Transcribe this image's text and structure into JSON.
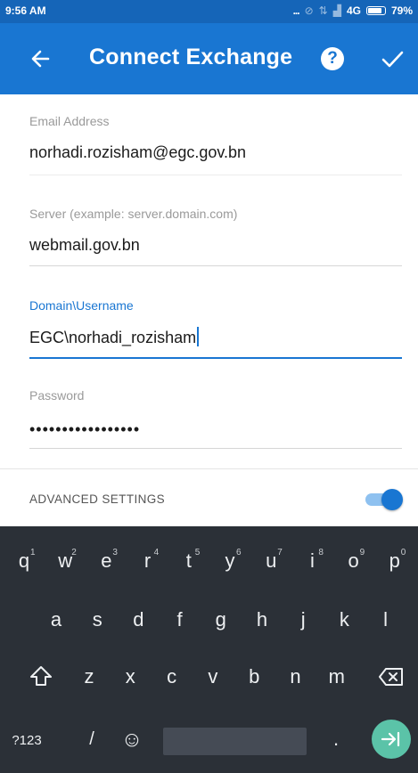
{
  "status_bar": {
    "time": "9:56 AM",
    "dots": "...",
    "network": "4G",
    "battery": "79%"
  },
  "app_bar": {
    "title": "Connect Exchange",
    "help_glyph": "?"
  },
  "form": {
    "email": {
      "label": "Email Address",
      "value": "norhadi.rozisham@egc.gov.bn"
    },
    "server": {
      "label": "Server (example: server.domain.com)",
      "value": "webmail.gov.bn"
    },
    "username": {
      "label": "Domain\\Username",
      "value": "EGC\\norhadi_rozisham"
    },
    "password": {
      "label": "Password",
      "value": "•••••••••••••••••"
    },
    "advanced": {
      "label": "ADVANCED SETTINGS",
      "enabled": true
    }
  },
  "keyboard": {
    "row1": [
      {
        "key": "q",
        "num": "1"
      },
      {
        "key": "w",
        "num": "2"
      },
      {
        "key": "e",
        "num": "3"
      },
      {
        "key": "r",
        "num": "4"
      },
      {
        "key": "t",
        "num": "5"
      },
      {
        "key": "y",
        "num": "6"
      },
      {
        "key": "u",
        "num": "7"
      },
      {
        "key": "i",
        "num": "8"
      },
      {
        "key": "o",
        "num": "9"
      },
      {
        "key": "p",
        "num": "0"
      }
    ],
    "row2": [
      "a",
      "s",
      "d",
      "f",
      "g",
      "h",
      "j",
      "k",
      "l"
    ],
    "row3": [
      "z",
      "x",
      "c",
      "v",
      "b",
      "n",
      "m"
    ],
    "symbols": "?123",
    "slash": "/",
    "period": ".",
    "emoji_glyph": "☺"
  },
  "colors": {
    "status_bar": "#1565b8",
    "app_bar": "#1976d2",
    "accent": "#1976d2",
    "keyboard_bg": "#2b3037",
    "enter_key": "#5bc3a8"
  },
  "icons": {
    "back": "arrow-left-icon",
    "help": "help-circle-icon",
    "confirm": "check-icon",
    "shift": "shift-icon",
    "backspace": "backspace-icon",
    "emoji": "emoji-icon",
    "enter": "next-arrow-icon"
  }
}
